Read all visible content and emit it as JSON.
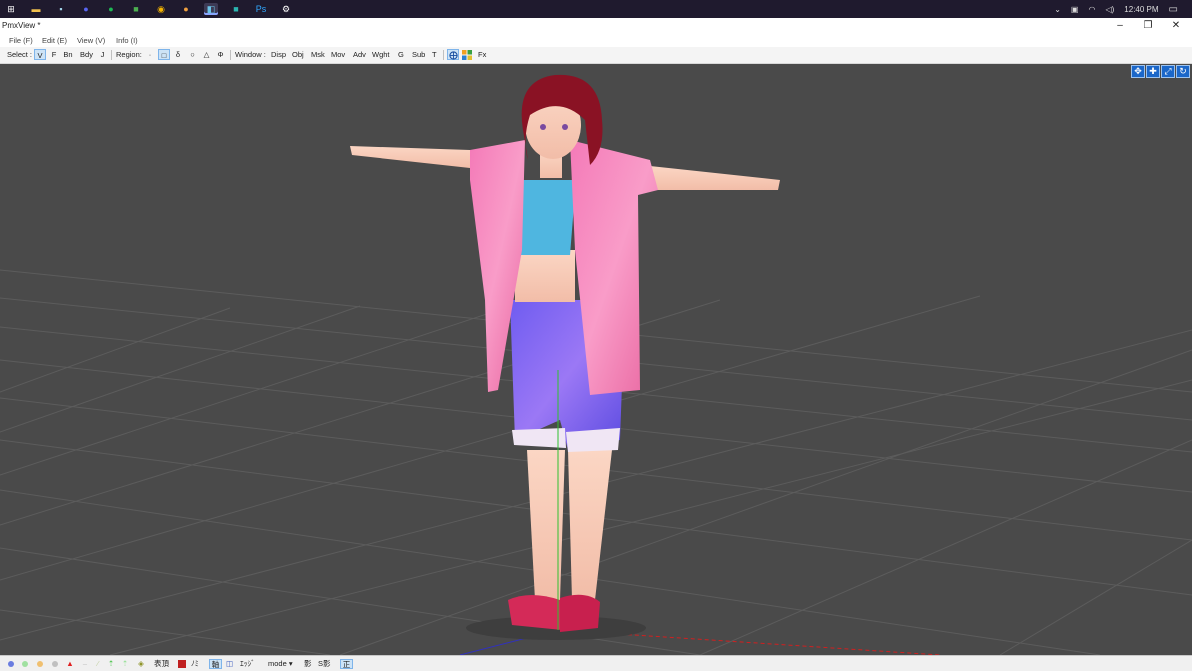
{
  "taskbar": {
    "apps": [
      {
        "name": "windows-start-icon",
        "glyph": "⊞",
        "color": "#ffffff",
        "active": false
      },
      {
        "name": "file-explorer-icon",
        "glyph": "▬",
        "color": "#f2c14e",
        "active": false
      },
      {
        "name": "notes-app-icon",
        "glyph": "▪",
        "color": "#9fd3e6",
        "active": false
      },
      {
        "name": "discord-icon",
        "glyph": "●",
        "color": "#5865f2",
        "active": false
      },
      {
        "name": "spotify-icon",
        "glyph": "●",
        "color": "#1db954",
        "active": false
      },
      {
        "name": "green-app-icon",
        "glyph": "■",
        "color": "#4caf50",
        "active": false
      },
      {
        "name": "chrome-icon",
        "glyph": "◉",
        "color": "#f4b400",
        "active": false
      },
      {
        "name": "emoji-app-icon",
        "glyph": "●",
        "color": "#f0a040",
        "active": false
      },
      {
        "name": "pmxview-app-icon",
        "glyph": "◧",
        "color": "#6bc4e8",
        "active": true
      },
      {
        "name": "teal-app-icon",
        "glyph": "■",
        "color": "#2bb5b0",
        "active": false
      },
      {
        "name": "photoshop-icon",
        "glyph": "Ps",
        "color": "#31a8ff",
        "active": false
      },
      {
        "name": "settings-icon",
        "glyph": "⚙",
        "color": "#ffffff",
        "active": false
      }
    ],
    "clock": "12:40 PM"
  },
  "window": {
    "title": "PmxView *"
  },
  "menu": [
    "File (F)",
    "Edit (E)",
    "View (V)",
    "Info (I)"
  ],
  "toolbar": {
    "select_label": "Select :",
    "select_modes": [
      "V",
      "F",
      "Bn",
      "Bdy",
      "J"
    ],
    "region_label": "Region:",
    "region_modes": [
      "·",
      "□",
      "δ",
      "○",
      "△",
      "Φ"
    ],
    "window_label": "Window :",
    "window_items": [
      "Disp",
      "Obj",
      "Msk",
      "Mov",
      "Adv",
      "Wght",
      "G",
      "Sub",
      "T"
    ],
    "fx_label": "Fx"
  },
  "bottombar": {
    "display_items": [
      "表頂",
      "ﾉﾐ",
      "軸",
      "ｴｯｼﾞ",
      "mode",
      "影",
      "S影",
      "正"
    ],
    "selected": [
      "軸",
      "正"
    ]
  }
}
